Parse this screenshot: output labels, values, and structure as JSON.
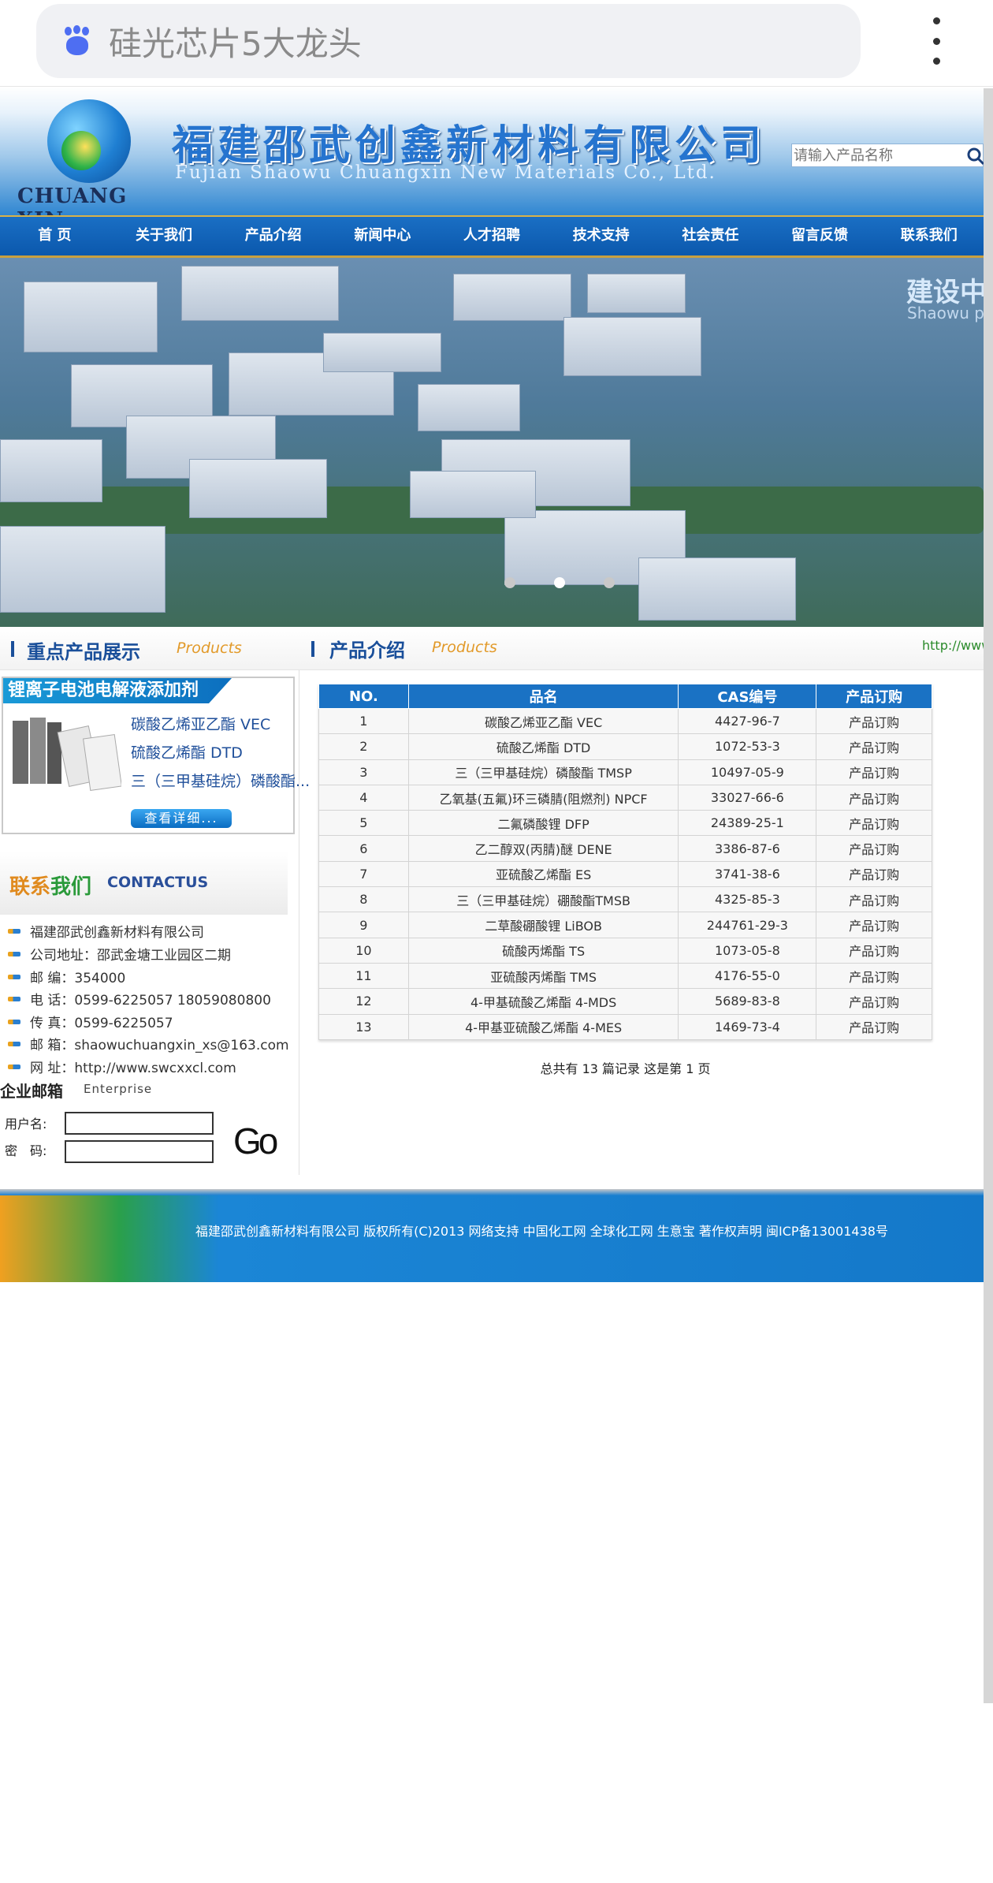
{
  "browser": {
    "search_query": "硅光芯片5大龙头",
    "search_icon": "baidu-paw-icon",
    "menu_icon": "more-vertical-icon"
  },
  "header": {
    "logo_text": "CHUANG XIN",
    "company_cn": "福建邵武创鑫新材料有限公司",
    "company_en": "Fujian Shaowu Chuangxin New Materials Co., Ltd.",
    "search_placeholder": "请输入产品名称",
    "search_icon": "magnifier-icon"
  },
  "nav": {
    "items": [
      "首 页",
      "关于我们",
      "产品介绍",
      "新闻中心",
      "人才招聘",
      "技术支持",
      "社会责任",
      "留言反馈",
      "联系我们"
    ]
  },
  "banner": {
    "title": "建设中",
    "subtitle": "Shaowu pro",
    "dots": 3
  },
  "sections": {
    "left_title": "重点产品展示",
    "left_en": "Products",
    "right_title": "产品介绍",
    "right_en": "Products",
    "link_text": "http://www.s"
  },
  "featured": {
    "heading": "锂离子电池电解液添加剂",
    "links": [
      "碳酸乙烯亚乙酯 VEC",
      "硫酸乙烯酯 DTD",
      "三（三甲基硅烷）磷酸酯..."
    ],
    "more_button": "查看详细..."
  },
  "contact": {
    "title_a": "联系",
    "title_b": "我们",
    "title_en": "CONTACTUS",
    "rows": [
      "福建邵武创鑫新材料有限公司",
      "公司地址：邵武金塘工业园区二期",
      "邮 编：354000",
      "电 话：0599-6225057  18059080800",
      "传 真：0599-6225057",
      "邮 箱：shaowuchuangxin_xs@163.com",
      "网 址：http://www.swcxxcl.com"
    ]
  },
  "mailbox": {
    "title": "企业邮箱",
    "title_en": "Enterprise",
    "username_label": "用户名:",
    "password_label": "密　码:",
    "go_label": "Go"
  },
  "table": {
    "headers": [
      "NO.",
      "品名",
      "CAS编号",
      "产品订购"
    ],
    "rows": [
      [
        "1",
        "碳酸乙烯亚乙酯 VEC",
        "4427-96-7",
        "产品订购"
      ],
      [
        "2",
        "硫酸乙烯酯 DTD",
        "1072-53-3",
        "产品订购"
      ],
      [
        "3",
        "三（三甲基硅烷）磷酸酯 TMSP",
        "10497-05-9",
        "产品订购"
      ],
      [
        "4",
        "乙氧基(五氟)环三磷腈(阻燃剂) NPCF",
        "33027-66-6",
        "产品订购"
      ],
      [
        "5",
        "二氟磷酸锂 DFP",
        "24389-25-1",
        "产品订购"
      ],
      [
        "6",
        "乙二醇双(丙腈)醚 DENE",
        "3386-87-6",
        "产品订购"
      ],
      [
        "7",
        "亚硫酸乙烯酯 ES",
        "3741-38-6",
        "产品订购"
      ],
      [
        "8",
        "三（三甲基硅烷）硼酸酯TMSB",
        "4325-85-3",
        "产品订购"
      ],
      [
        "9",
        "二草酸硼酸锂 LiBOB",
        "244761-29-3",
        "产品订购"
      ],
      [
        "10",
        "硫酸丙烯酯 TS",
        "1073-05-8",
        "产品订购"
      ],
      [
        "11",
        "亚硫酸丙烯酯 TMS",
        "4176-55-0",
        "产品订购"
      ],
      [
        "12",
        "4-甲基硫酸乙烯酯 4-MDS",
        "5689-83-8",
        "产品订购"
      ],
      [
        "13",
        "4-甲基亚硫酸乙烯酯 4-MES",
        "1469-73-4",
        "产品订购"
      ]
    ],
    "pager": "总共有 13 篇记录 这是第 1 页"
  },
  "footer": {
    "text": "福建邵武创鑫新材料有限公司 版权所有(C)2013  网络支持 中国化工网 全球化工网 生意宝 著作权声明 闽ICP备13001438号"
  },
  "colors": {
    "brand_blue": "#1a72c4",
    "accent_orange": "#e29a2a",
    "nav_gold": "#d7b24a"
  }
}
